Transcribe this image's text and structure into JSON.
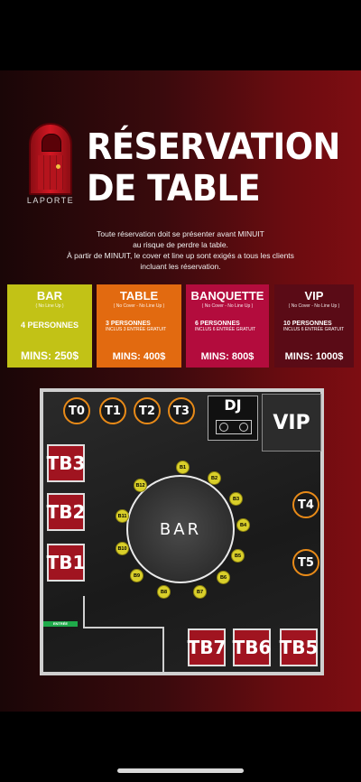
{
  "logo": {
    "text": "LAPORTE"
  },
  "title": {
    "line1": "RÉSERVATION",
    "line2": "DE TABLE"
  },
  "notice": {
    "line1": "Toute réservation doit se présenter avant MINUIT",
    "line2": "au risque de perdre la table.",
    "line3": "À partir de MINUIT, le cover et line up sont exigés a tous les clients",
    "line4": "incluant les réservation."
  },
  "pricing": [
    {
      "name": "BAR",
      "sub": "( No Line Up )",
      "people": "4 PERSONNES",
      "includes": "",
      "mins": "MINS: 250$"
    },
    {
      "name": "TABLE",
      "sub": "( No Cover - No Line Up )",
      "people": "3 PERSONNES",
      "includes": "INCLUS 3 ENTRÉE GRATUIT",
      "mins": "MINS: 400$"
    },
    {
      "name": "BANQUETTE",
      "sub": "( No Cover - No Line Up )",
      "people": "6 PERSONNES",
      "includes": "INCLUS 6 ENTRÉE GRATUIT",
      "mins": "MINS: 800$"
    },
    {
      "name": "VIP",
      "sub": "( No Cover - No Line Up )",
      "people": "10 PERSONNES",
      "includes": "INCLUS 6 ENTRÉE GRATUIT",
      "mins": "MINS: 1000$"
    }
  ],
  "floor": {
    "round_tables": [
      "T0",
      "T1",
      "T2",
      "T3",
      "T4",
      "T5"
    ],
    "banquettes": [
      "TB3",
      "TB2",
      "TB1",
      "TB7",
      "TB6",
      "TB5"
    ],
    "dj": "DJ",
    "vip": "VIP",
    "bar": "BAR",
    "stools": [
      "B1",
      "B2",
      "B3",
      "B4",
      "B5",
      "B6",
      "B7",
      "B8",
      "B9",
      "B10",
      "B11",
      "B12"
    ],
    "entrance": "ENTRÉE"
  },
  "colors": {
    "bar_card": "#c2c216",
    "table_card": "#e26a10",
    "banquette_card": "#b30c3d",
    "vip_card": "#5a0b16",
    "round_table_border": "#e88a18",
    "banquette": "#a01420",
    "stool": "#d9cf2a",
    "entrance": "#1faa4a"
  }
}
